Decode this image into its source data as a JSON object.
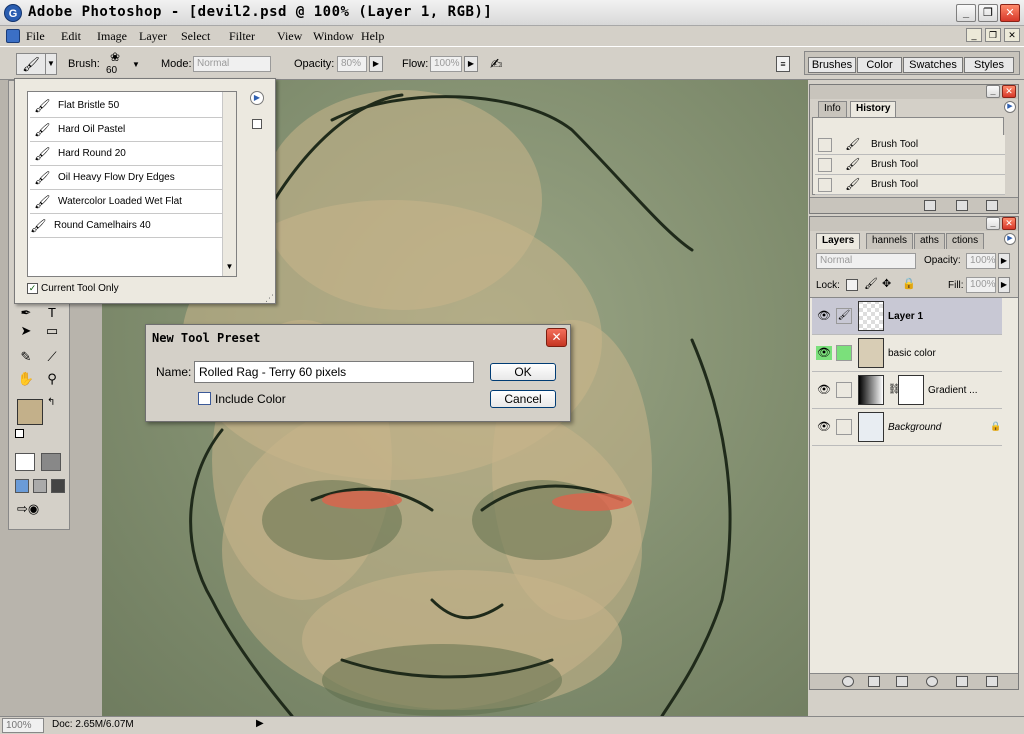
{
  "window": {
    "title": "Adobe Photoshop - [devil2.psd @ 100% (Layer 1, RGB)]",
    "app_icon_glyph": "G",
    "minimize_glyph": "_",
    "restore_glyph": "❐",
    "close_glyph": "✕"
  },
  "menu": {
    "items": [
      "File",
      "Edit",
      "Image",
      "Layer",
      "Select",
      "Filter",
      "View",
      "Window",
      "Help"
    ]
  },
  "options": {
    "brush_label": "Brush:",
    "brush_size": "60",
    "mode_label": "Mode:",
    "mode_value": "Normal",
    "opacity_label": "Opacity:",
    "opacity_value": "80%",
    "flow_label": "Flow:",
    "flow_value": "100%"
  },
  "palette_well": {
    "tabs": [
      "Brushes",
      "Color",
      "Swatches",
      "Styles"
    ]
  },
  "brush_popup": {
    "presets": [
      "Flat Bristle 50",
      "Hard Oil Pastel",
      "Hard Round 20",
      "Oil Heavy Flow Dry Edges",
      "Watercolor Loaded Wet Flat",
      "Round Camelhairs 40"
    ],
    "current_tool_only_label": "Current Tool Only",
    "current_tool_only_checked": true
  },
  "dialog": {
    "title": "New Tool Preset",
    "name_label": "Name:",
    "name_value": "Rolled Rag - Terry 60 pixels",
    "include_color_label": "Include Color",
    "include_color_checked": false,
    "ok_label": "OK",
    "cancel_label": "Cancel"
  },
  "history_panel": {
    "tabs": [
      "Info",
      "History"
    ],
    "active_tab": "History",
    "items": [
      "Brush Tool",
      "Brush Tool",
      "Brush Tool"
    ]
  },
  "layers_panel": {
    "tabs": [
      "Layers",
      "Channels",
      "Paths",
      "Actions"
    ],
    "tab_labels": [
      "Layers",
      "hannels",
      "aths",
      "ctions"
    ],
    "active_tab": "Layers",
    "blend_mode": "Normal",
    "opacity_label": "Opacity:",
    "opacity_value": "100%",
    "lock_label": "Lock:",
    "fill_label": "Fill:",
    "fill_value": "100%",
    "layers": [
      {
        "name": "Layer 1",
        "selected": true,
        "visible": true
      },
      {
        "name": "basic color",
        "selected": false,
        "visible": true
      },
      {
        "name": "Gradient ...",
        "selected": false,
        "visible": true
      },
      {
        "name": "Background",
        "selected": false,
        "visible": true,
        "locked": true
      }
    ]
  },
  "colors": {
    "foreground": "#c3b08a",
    "background": "#a99a72",
    "canvas_skin": "#c9b48a",
    "canvas_bg": "#7f8c6d",
    "eye_glow": "#d8654e"
  },
  "status": {
    "zoom": "100%",
    "doc_info": "Doc: 2.65M/6.07M"
  }
}
